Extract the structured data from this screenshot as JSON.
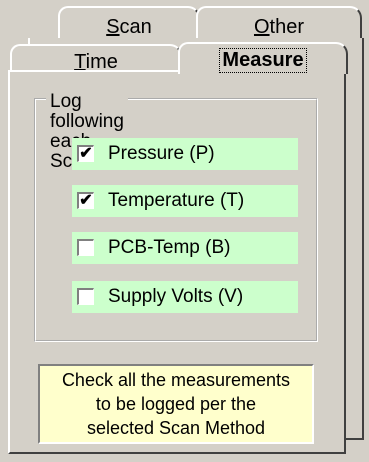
{
  "tabs": {
    "scan": {
      "prefix": "",
      "accel": "S",
      "rest": "can"
    },
    "other": {
      "prefix": "",
      "accel": "O",
      "rest": "ther"
    },
    "time": {
      "prefix": "",
      "accel": "T",
      "rest": "ime"
    },
    "measure": {
      "label": "Measure"
    }
  },
  "group": {
    "label": "Log following each Scan:"
  },
  "options": [
    {
      "label": "Pressure (P)",
      "checked": "✔"
    },
    {
      "label": "Temperature (T)",
      "checked": "✔"
    },
    {
      "label": "PCB-Temp (B)",
      "checked": ""
    },
    {
      "label": "Supply Volts (V)",
      "checked": ""
    }
  ],
  "note": {
    "line1": "Check all the measurements",
    "line2": "to be logged per the",
    "line3": "selected Scan Method"
  },
  "colors": {
    "face": "#d4d0c8",
    "checkbox_row": "#ccffcc",
    "note_bg": "#ffffcc"
  }
}
